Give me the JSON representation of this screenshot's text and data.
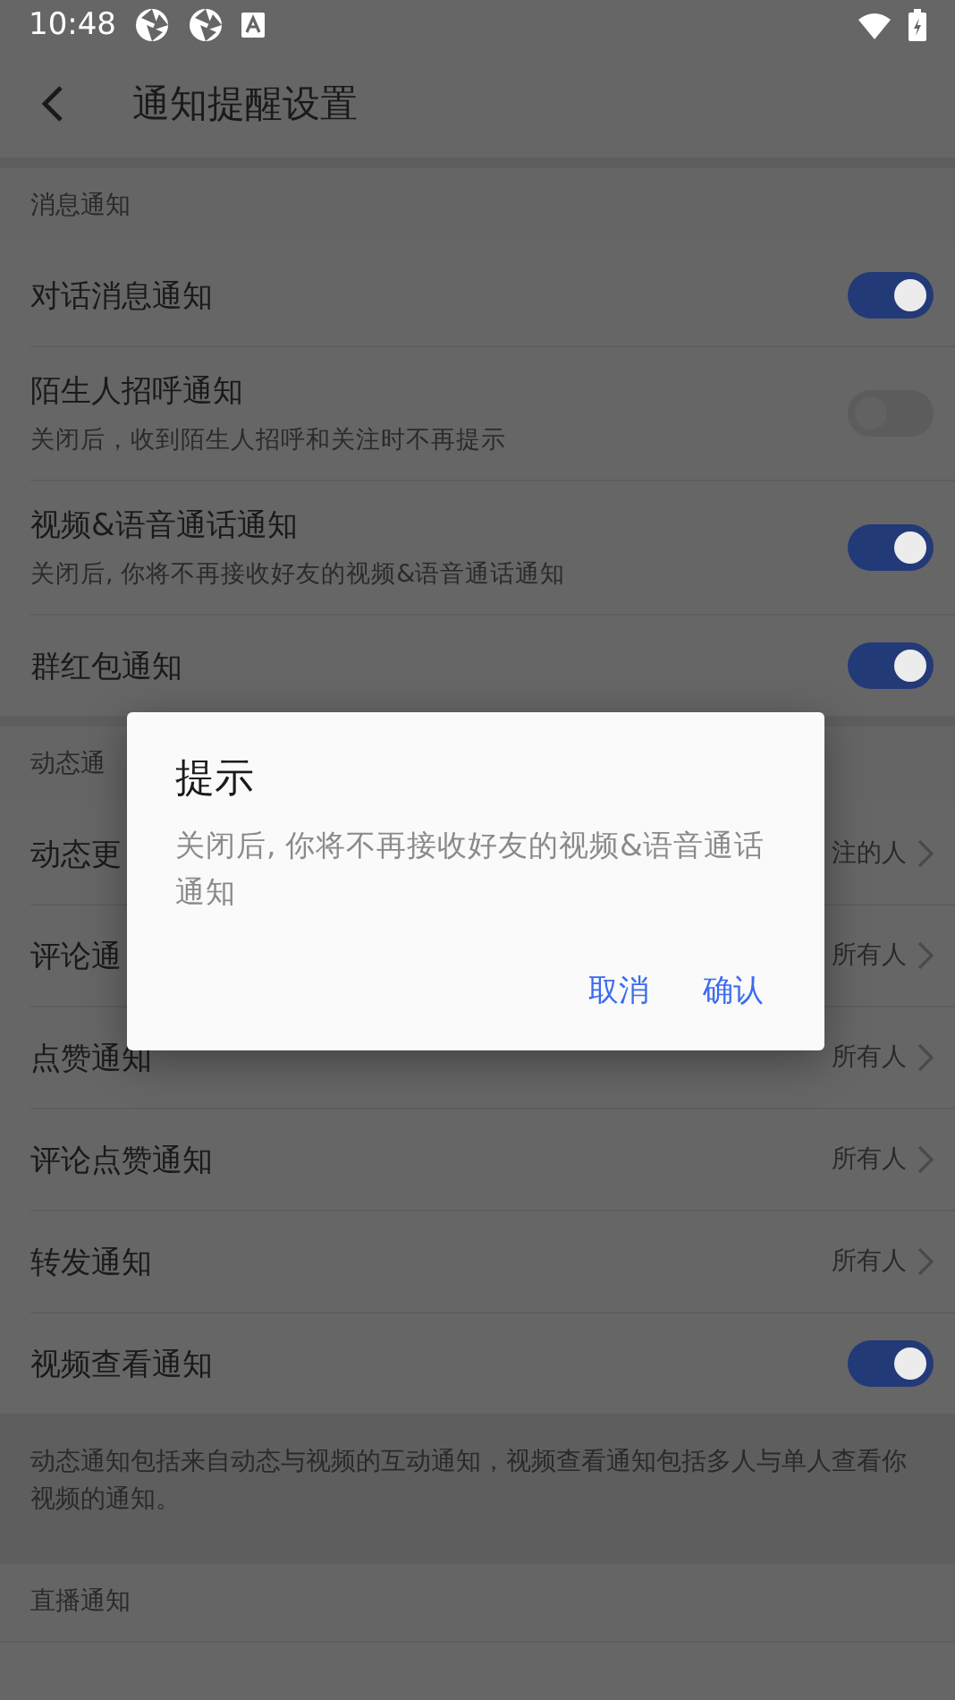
{
  "status_bar": {
    "time": "10:48"
  },
  "app_bar": {
    "title": "通知提醒设置"
  },
  "sections": [
    {
      "header": "消息通知",
      "rows": [
        {
          "kind": "toggle",
          "title": "对话消息通知",
          "on": true
        },
        {
          "kind": "toggle",
          "title": "陌生人招呼通知",
          "subtitle": "关闭后，收到陌生人招呼和关注时不再提示",
          "on": false
        },
        {
          "kind": "toggle",
          "title": "视频&语音通话通知",
          "subtitle": "关闭后, 你将不再接收好友的视频&语音通话通知",
          "on": true
        },
        {
          "kind": "toggle",
          "title": "群红包通知",
          "on": true
        }
      ]
    },
    {
      "header": "动态通",
      "rows": [
        {
          "kind": "value",
          "title": "动态更",
          "value": "注的人"
        },
        {
          "kind": "value",
          "title": "评论通",
          "value": "所有人"
        },
        {
          "kind": "value",
          "title": "点赞通知",
          "value": "所有人"
        },
        {
          "kind": "value",
          "title": "评论点赞通知",
          "value": "所有人"
        },
        {
          "kind": "value",
          "title": "转发通知",
          "value": "所有人"
        },
        {
          "kind": "toggle",
          "title": "视频查看通知",
          "on": true
        }
      ],
      "footnote": "动态通知包括来自动态与视频的互动通知，视频查看通知包括多人与单人查看你视频的通知。"
    },
    {
      "header": "直播通知"
    }
  ],
  "dialog": {
    "title": "提示",
    "message": "关闭后, 你将不再接收好友的视频&语音通话通知",
    "buttons": [
      "取消",
      "确认"
    ]
  }
}
